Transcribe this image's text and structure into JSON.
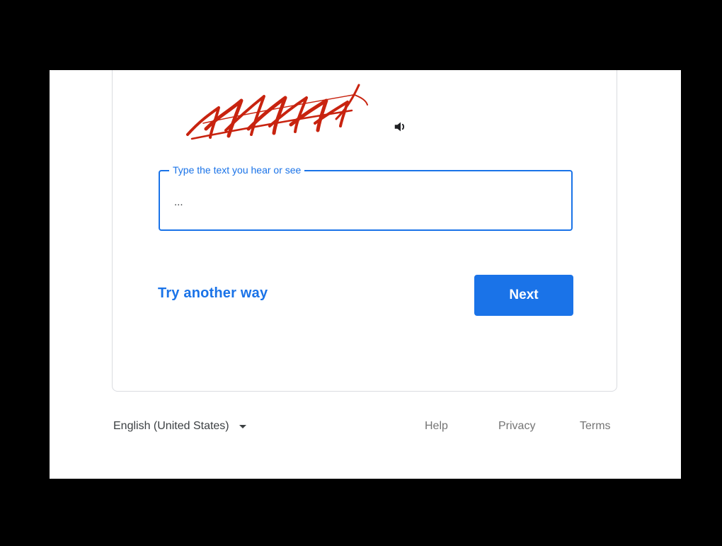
{
  "captcha": {
    "image_icon": "captcha-image",
    "audio_icon": "speaker-icon"
  },
  "input": {
    "label": "Type the text you hear or see",
    "value": "..."
  },
  "actions": {
    "try_another": "Try another way",
    "next": "Next"
  },
  "footer": {
    "language": "English (United States)",
    "links": [
      "Help",
      "Privacy",
      "Terms"
    ]
  },
  "colors": {
    "accent": "#1a73e8",
    "captcha_red": "#c8230f",
    "background": "#000000"
  }
}
